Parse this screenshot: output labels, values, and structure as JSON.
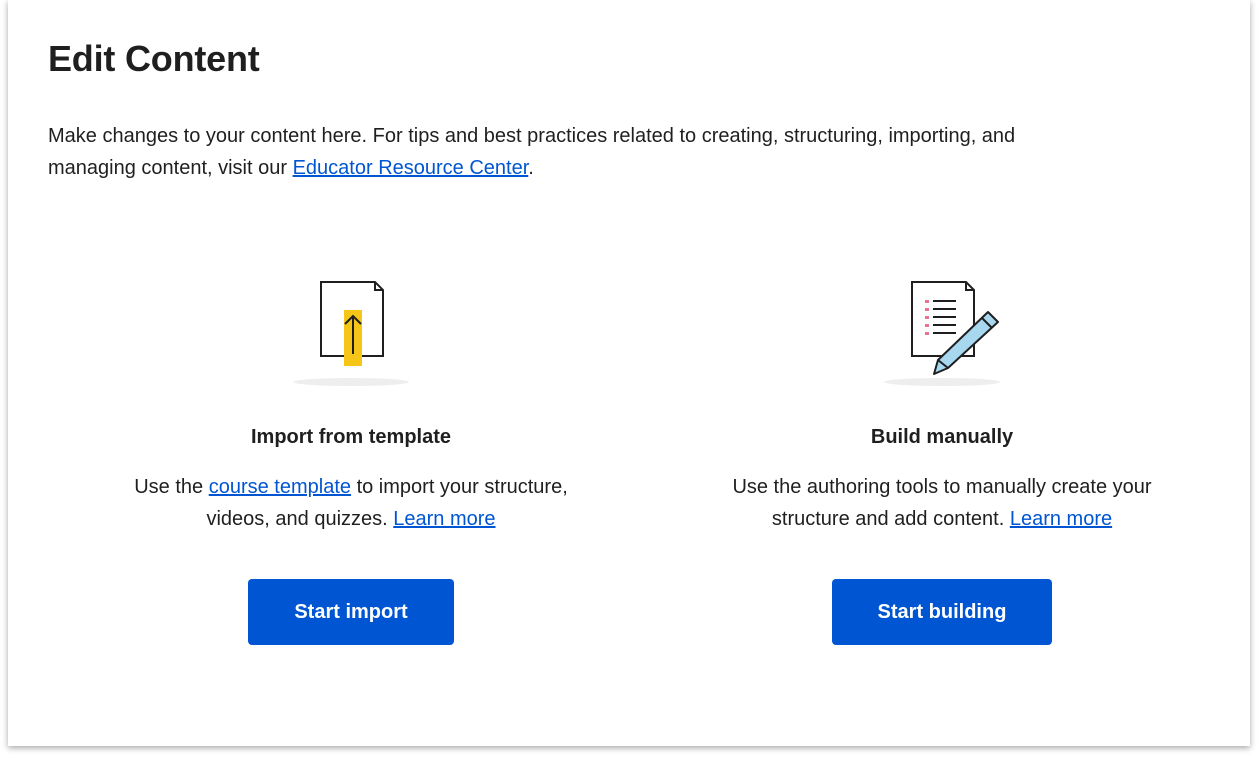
{
  "page": {
    "title": "Edit Content",
    "intro_text": "Make changes to your content here. For tips and best practices related to creating, structuring, importing, and managing content, visit our ",
    "intro_link": "Educator Resource Center",
    "intro_end": "."
  },
  "import_card": {
    "icon": "document-upload-icon",
    "title": "Import from template",
    "desc_prefix": "Use the ",
    "template_link": "course template",
    "desc_middle": " to import your structure, videos, and quizzes. ",
    "learn_more": "Learn more",
    "button_label": "Start import"
  },
  "build_card": {
    "icon": "document-pencil-icon",
    "title": "Build manually",
    "desc": "Use the authoring tools to manually create your structure and add content. ",
    "learn_more": "Learn more",
    "button_label": "Start building"
  },
  "colors": {
    "accent": "#0056d2",
    "upload_arrow_bg": "#f5c518",
    "pencil_fill": "#a8d8f0",
    "list_bullets": "#e8748a"
  }
}
